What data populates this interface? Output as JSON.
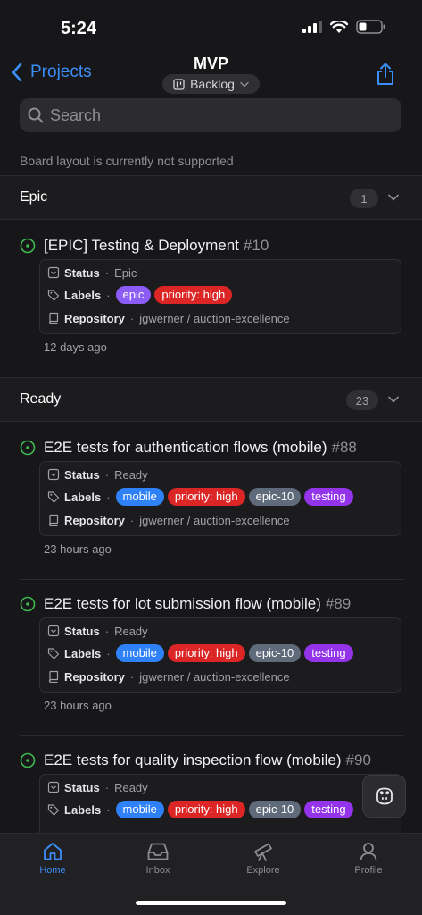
{
  "status_bar": {
    "time": "5:24"
  },
  "nav": {
    "back_label": "Projects",
    "title": "MVP",
    "view_label": "Backlog"
  },
  "search": {
    "placeholder": "Search"
  },
  "notice": "Board layout is currently not supported",
  "field_labels": {
    "status": "Status",
    "labels": "Labels",
    "repository": "Repository"
  },
  "groups": [
    {
      "title": "Epic",
      "count": "1",
      "items": [
        {
          "title": "[EPIC] Testing & Deployment",
          "number": "#10",
          "status": "Epic",
          "labels": [
            {
              "name": "epic",
              "color": "#8b5cf6"
            },
            {
              "name": "priority: high",
              "color": "#dc2626"
            }
          ],
          "repository": "jgwerner / auction-excellence",
          "updated": "12 days ago"
        }
      ]
    },
    {
      "title": "Ready",
      "count": "23",
      "items": [
        {
          "title": "E2E tests for authentication flows (mobile)",
          "number": "#88",
          "status": "Ready",
          "labels": [
            {
              "name": "mobile",
              "color": "#2f81f7"
            },
            {
              "name": "priority: high",
              "color": "#dc2626"
            },
            {
              "name": "epic-10",
              "color": "#5f6b7a"
            },
            {
              "name": "testing",
              "color": "#9333ea"
            }
          ],
          "repository": "jgwerner / auction-excellence",
          "updated": "23 hours ago"
        },
        {
          "title": "E2E tests for lot submission flow (mobile)",
          "number": "#89",
          "status": "Ready",
          "labels": [
            {
              "name": "mobile",
              "color": "#2f81f7"
            },
            {
              "name": "priority: high",
              "color": "#dc2626"
            },
            {
              "name": "epic-10",
              "color": "#5f6b7a"
            },
            {
              "name": "testing",
              "color": "#9333ea"
            }
          ],
          "repository": "jgwerner / auction-excellence",
          "updated": "23 hours ago"
        },
        {
          "title": "E2E tests for quality inspection flow (mobile)",
          "number": "#90",
          "status": "Ready",
          "labels": [
            {
              "name": "mobile",
              "color": "#2f81f7"
            },
            {
              "name": "priority: high",
              "color": "#dc2626"
            },
            {
              "name": "epic-10",
              "color": "#5f6b7a"
            },
            {
              "name": "testing",
              "color": "#9333ea"
            }
          ]
        }
      ]
    }
  ],
  "tabbar": {
    "home": "Home",
    "inbox": "Inbox",
    "explore": "Explore",
    "profile": "Profile"
  },
  "colors": {
    "accent": "#3b8ef7",
    "open_issue": "#3fb950",
    "background": "#17171a"
  }
}
